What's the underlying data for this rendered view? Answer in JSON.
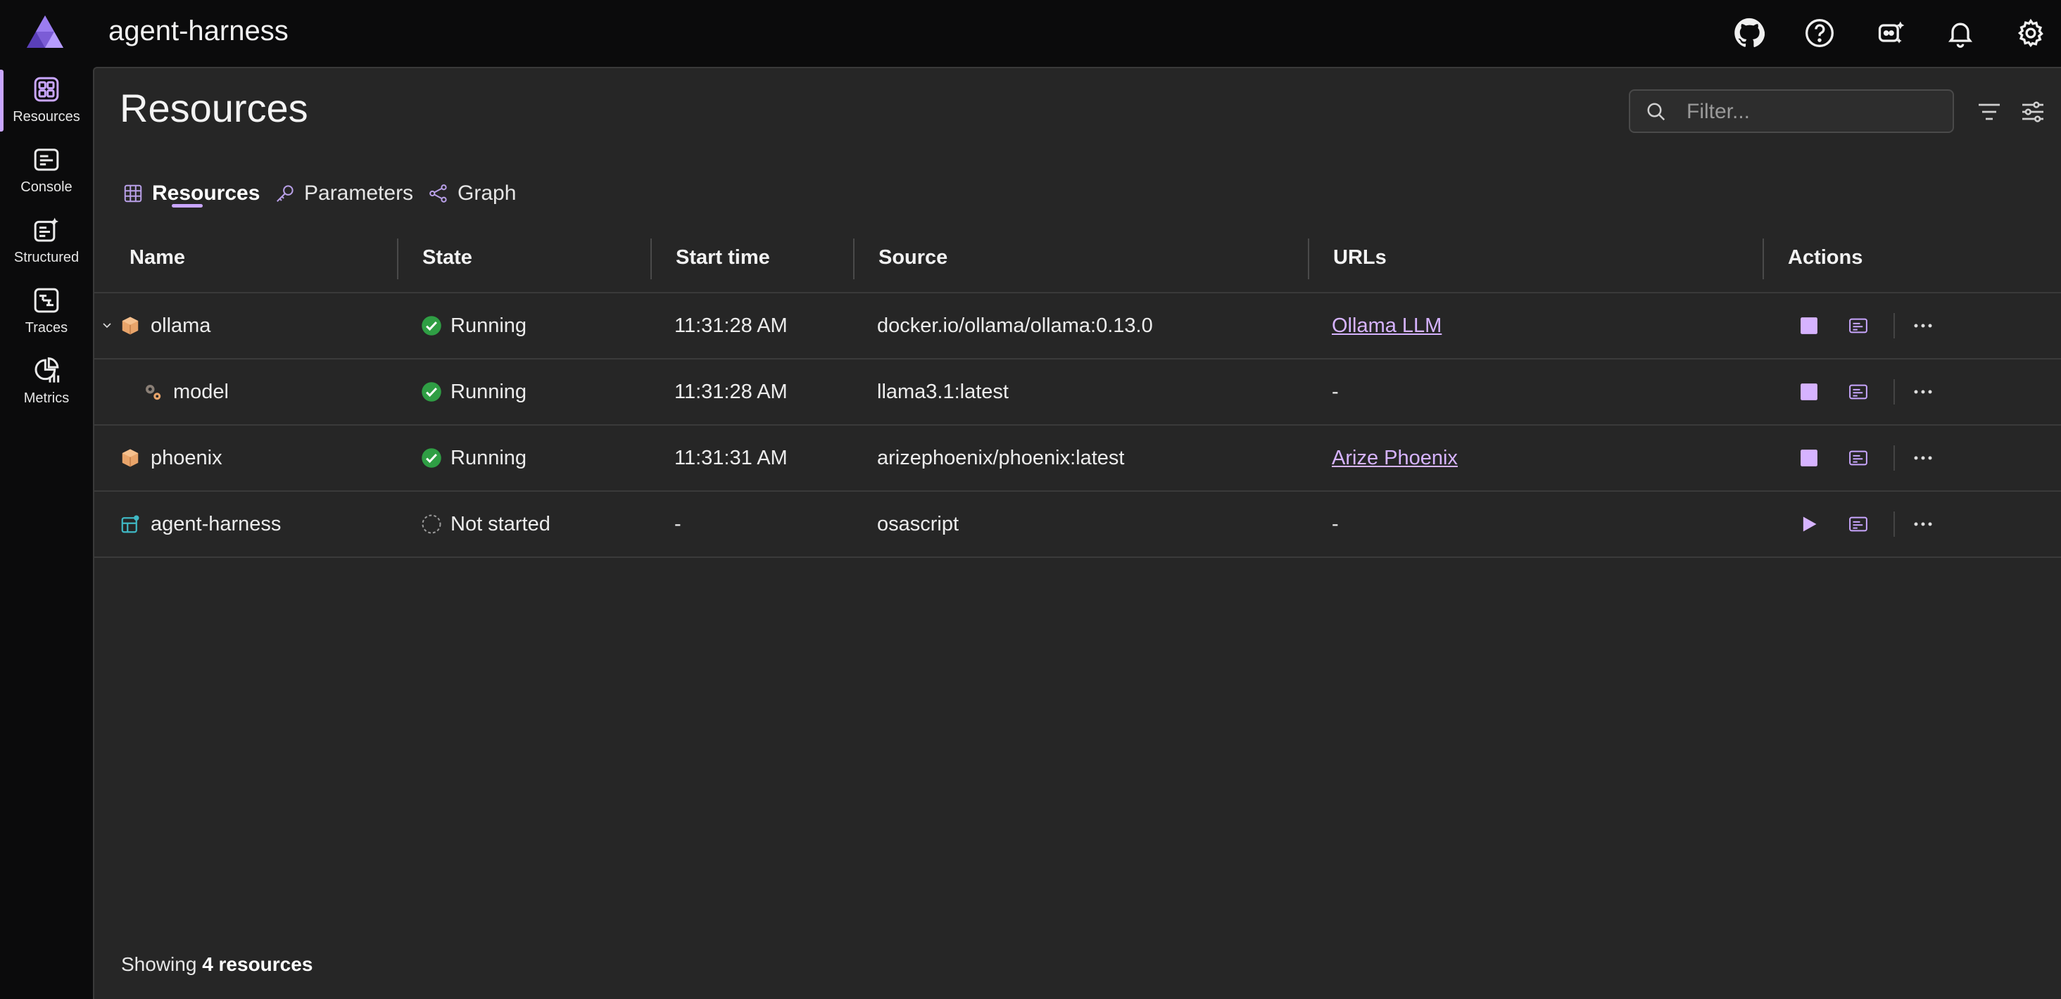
{
  "app": {
    "title": "agent-harness",
    "top_icons": [
      "github-icon",
      "help-icon",
      "copilot-icon",
      "bell-icon",
      "gear-icon"
    ]
  },
  "sidebar": {
    "items": [
      {
        "label": "Resources",
        "icon": "grid-icon",
        "active": true
      },
      {
        "label": "Console",
        "icon": "console-icon",
        "active": false
      },
      {
        "label": "Structured",
        "icon": "structured-logs-icon",
        "active": false
      },
      {
        "label": "Traces",
        "icon": "traces-icon",
        "active": false
      },
      {
        "label": "Metrics",
        "icon": "metrics-icon",
        "active": false
      }
    ]
  },
  "page": {
    "title": "Resources",
    "filter_placeholder": "Filter..."
  },
  "tabs": [
    {
      "label": "Resources",
      "icon": "table-icon",
      "active": true
    },
    {
      "label": "Parameters",
      "icon": "key-icon",
      "active": false
    },
    {
      "label": "Graph",
      "icon": "graph-icon",
      "active": false
    }
  ],
  "table": {
    "columns": [
      "Name",
      "State",
      "Start time",
      "Source",
      "URLs",
      "Actions"
    ],
    "rows": [
      {
        "name": "ollama",
        "state": "Running",
        "start": "11:31:28 AM",
        "source": "docker.io/ollama/ollama:0.13.0",
        "url": "Ollama LLM"
      },
      {
        "name": "model",
        "state": "Running",
        "start": "11:31:28 AM",
        "source": "llama3.1:latest",
        "url": "-"
      },
      {
        "name": "phoenix",
        "state": "Running",
        "start": "11:31:31 AM",
        "source": "arizephoenix/phoenix:latest",
        "url": "Arize Phoenix"
      },
      {
        "name": "agent-harness",
        "state": "Not started",
        "start": "-",
        "source": "osascript",
        "url": "-"
      }
    ]
  },
  "footer": {
    "prefix": "Showing",
    "count_text": "4 resources"
  },
  "colors": {
    "accent": "#c9a6ff",
    "running": "#2f9e44",
    "background": "#262626"
  }
}
